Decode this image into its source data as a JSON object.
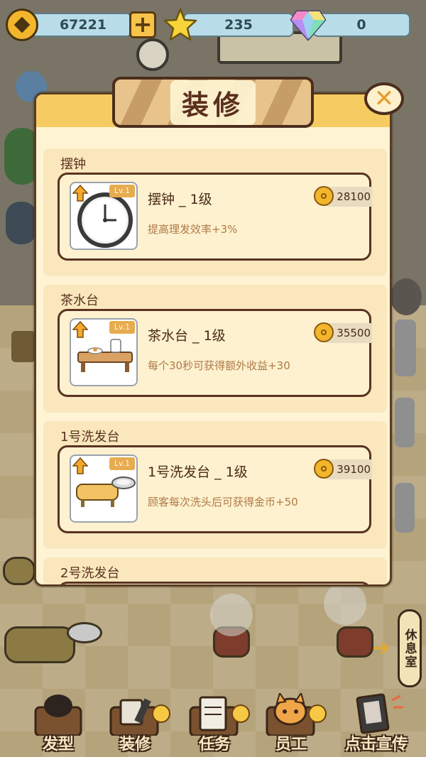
{
  "resources": {
    "coins": "67221",
    "stars": "235",
    "gems": "0"
  },
  "modal": {
    "title": "装修",
    "sections": [
      {
        "title": "摆钟",
        "item_name": "摆钟 _ 1级",
        "level_tag": "Lv.1",
        "description": "提高理发效率+3%",
        "price": "28100",
        "thumb_icon": "clock-icon"
      },
      {
        "title": "茶水台",
        "item_name": "茶水台 _ 1级",
        "level_tag": "Lv.1",
        "description": "每个30秒可获得额外收益+30",
        "price": "35500",
        "thumb_icon": "tea-table-icon"
      },
      {
        "title": "1号洗发台",
        "item_name": "1号洗发台 _ 1级",
        "level_tag": "Lv.1",
        "description": "顾客每次洗头后可获得金币+50",
        "price": "39100",
        "thumb_icon": "wash-bed-icon"
      },
      {
        "title": "2号洗发台"
      }
    ]
  },
  "rest_room_label": "休息室",
  "bottom_nav": [
    {
      "label": "发型",
      "icon": "hairstyle-icon"
    },
    {
      "label": "装修",
      "icon": "paint-bucket-icon"
    },
    {
      "label": "任务",
      "icon": "task-clipboard-icon"
    },
    {
      "label": "员工",
      "icon": "staff-cat-icon"
    },
    {
      "label": "点击宣传",
      "icon": "promote-poster-icon"
    }
  ],
  "colors": {
    "modal_bg": "#fef4d3",
    "section_bg": "#fae7bd",
    "header_band": "#f6cc62",
    "coin_gold": "#f2b52c",
    "desc_text": "#b07a48"
  }
}
